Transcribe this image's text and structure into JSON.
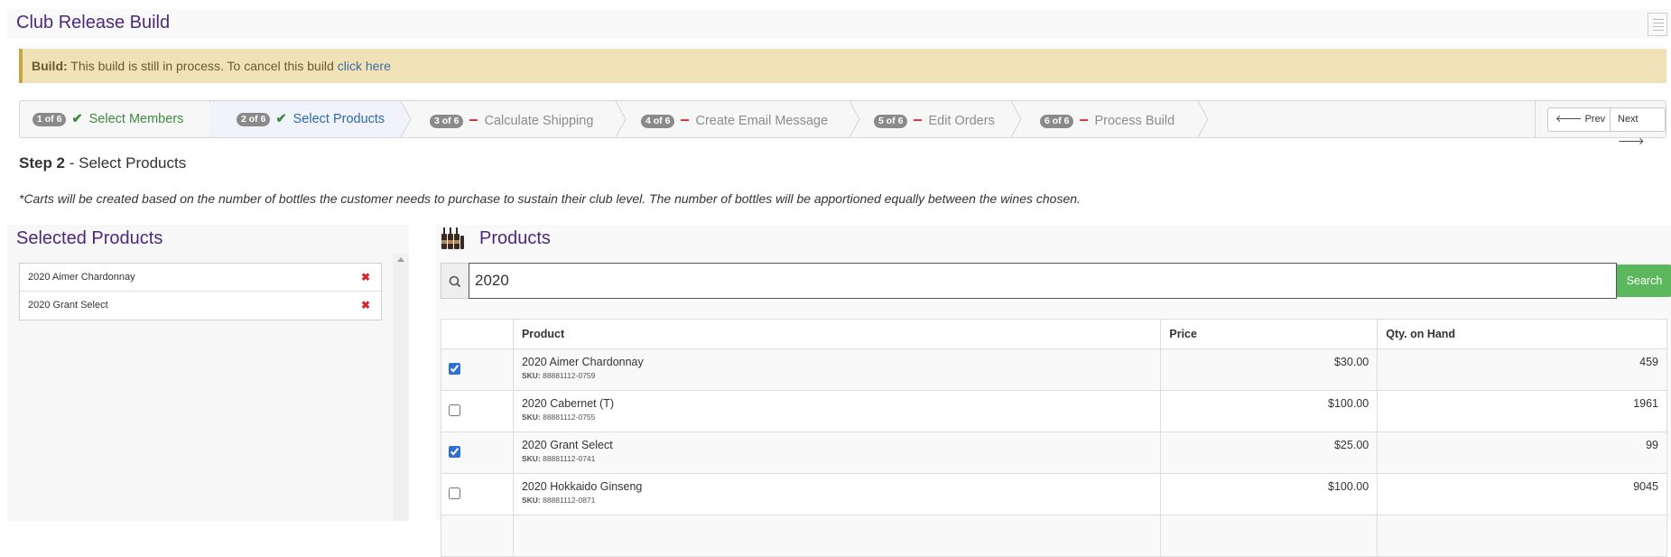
{
  "page": {
    "title": "Club Release Build"
  },
  "alert": {
    "label": "Build:",
    "message": " This build is still in process. To cancel this build ",
    "link": "click here"
  },
  "wizard": {
    "steps": [
      {
        "badge": "1 of 6",
        "label": "Select Members",
        "status": "complete"
      },
      {
        "badge": "2 of 6",
        "label": "Select Products",
        "status": "complete-active"
      },
      {
        "badge": "3 of 6",
        "label": "Calculate Shipping",
        "status": "incomplete"
      },
      {
        "badge": "4 of 6",
        "label": "Create Email Message",
        "status": "incomplete"
      },
      {
        "badge": "5 of 6",
        "label": "Edit Orders",
        "status": "incomplete"
      },
      {
        "badge": "6 of 6",
        "label": "Process Build",
        "status": "incomplete"
      }
    ],
    "prev_label": "Prev",
    "next_label": "Next"
  },
  "step": {
    "label": "Step 2",
    "title": " - Select Products",
    "note": "*Carts will be created based on the number of bottles the customer needs to purchase to sustain their club level. The number of bottles will be apportioned equally between the wines chosen."
  },
  "selected": {
    "title": "Selected Products",
    "items": [
      "2020 Aimer Chardonnay",
      "2020 Grant Select"
    ]
  },
  "products": {
    "title": "Products",
    "search": {
      "value": "2020",
      "button": "Search"
    },
    "columns": [
      "Product",
      "Price",
      "Qty. on Hand"
    ],
    "sku_label": "SKU:",
    "rows": [
      {
        "checked": true,
        "name": "2020 Aimer Chardonnay",
        "sku": "88881112-0759",
        "price": "$30.00",
        "qty": "459"
      },
      {
        "checked": false,
        "name": "2020 Cabernet (T)",
        "sku": "88881112-0755",
        "price": "$100.00",
        "qty": "1961"
      },
      {
        "checked": true,
        "name": "2020 Grant Select",
        "sku": "88881112-0741",
        "price": "$25.00",
        "qty": "99"
      },
      {
        "checked": false,
        "name": "2020 Hokkaido Ginseng",
        "sku": "88881112-0871",
        "price": "$100.00",
        "qty": "9045"
      }
    ]
  },
  "colors": {
    "title": "#4b2a7b",
    "alert_bg": "#f0e2b6",
    "success": "#3f8a3f",
    "danger": "#d9262b",
    "search_button": "#5cb85c"
  },
  "icons": {
    "notes": "notes-icon",
    "check": "check-icon",
    "dash": "minus-icon",
    "prev": "arrow-left-icon",
    "next": "arrow-right-icon",
    "remove": "remove-x-icon",
    "search": "search-icon",
    "products": "wine-bottles-icon"
  }
}
